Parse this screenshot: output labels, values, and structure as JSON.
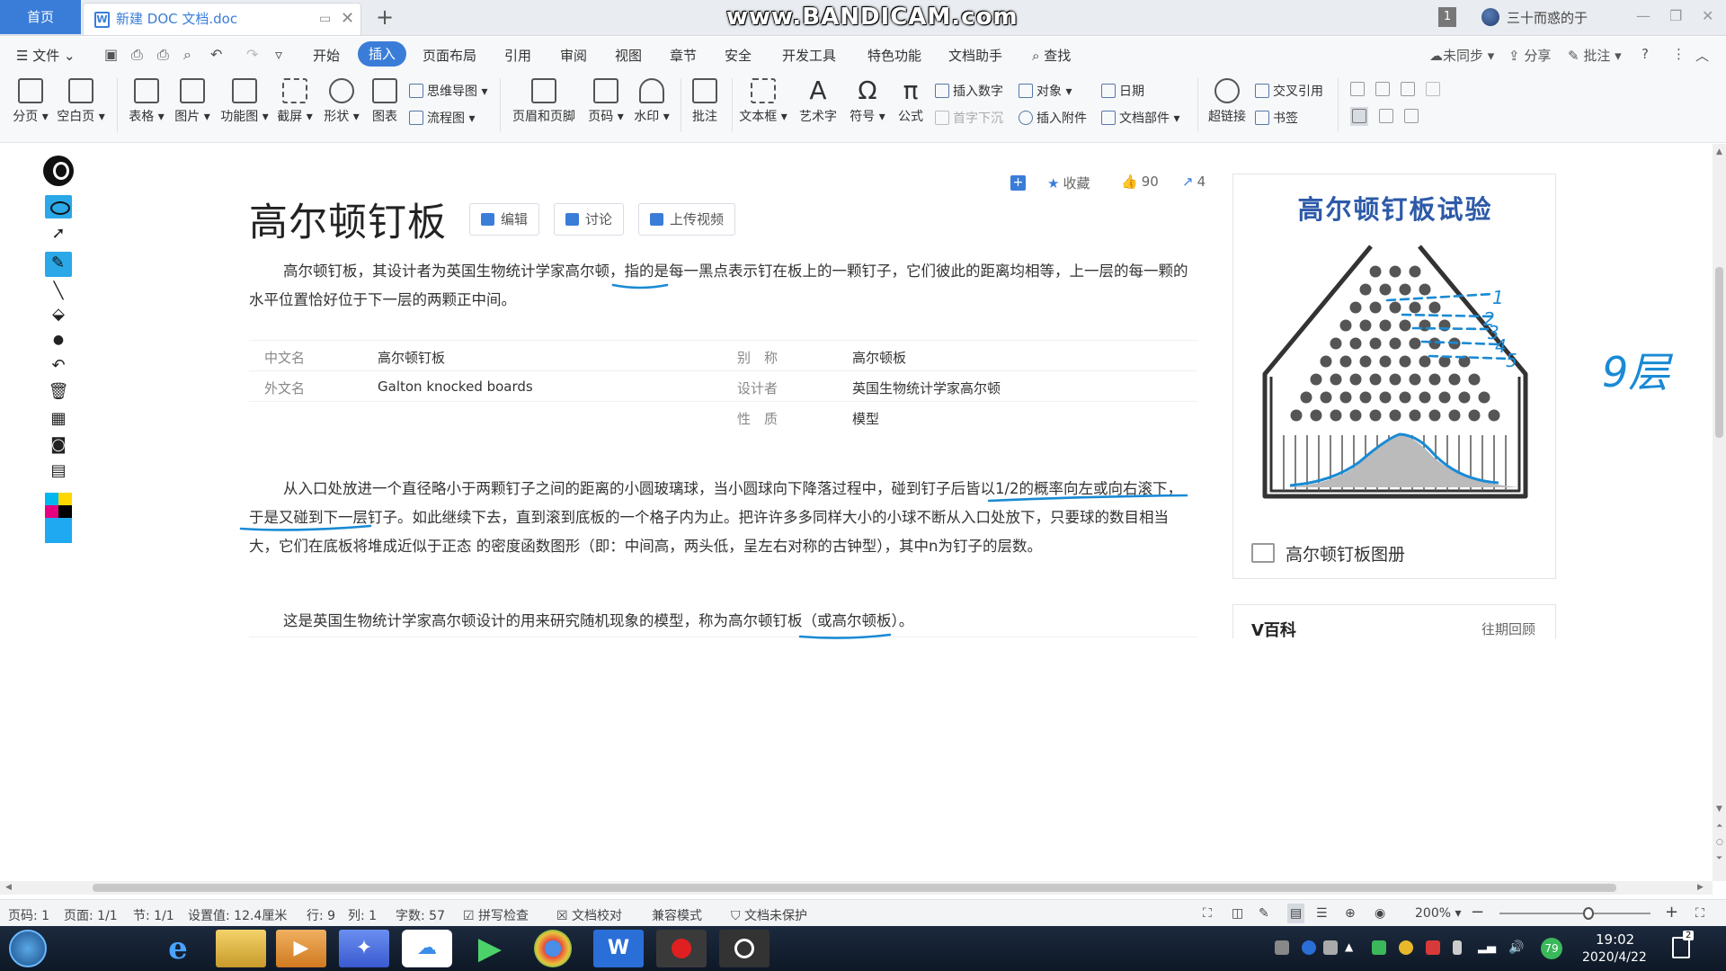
{
  "tabs": {
    "home": "首页",
    "doc": "新建 DOC 文档.doc",
    "doc_icon": "W",
    "new": "+"
  },
  "watermark": "www.BANDICAM.com",
  "titlebar": {
    "badge": "1",
    "user": "三十而惑的于"
  },
  "menu": {
    "file": "文件",
    "items": [
      "开始",
      "插入",
      "页面布局",
      "引用",
      "审阅",
      "视图",
      "章节",
      "安全",
      "开发工具",
      "特色功能",
      "文档助手"
    ],
    "search": "查找",
    "sync": "未同步",
    "share": "分享",
    "comment": "批注"
  },
  "ribbon": {
    "page_break": "分页",
    "blank_page": "空白页",
    "table": "表格",
    "picture": "图片",
    "function_chart": "功能图",
    "screenshot": "截屏",
    "shape": "形状",
    "chart": "图表",
    "mindmap": "思维导图",
    "flowchart": "流程图",
    "header_footer": "页眉和页脚",
    "page_number": "页码",
    "watermark": "水印",
    "annotation": "批注",
    "textbox": "文本框",
    "wordart": "艺术字",
    "symbol": "符号",
    "formula": "公式",
    "insert_number": "插入数字",
    "object": "对象",
    "date": "日期",
    "drop_cap": "首字下沉",
    "attachment": "插入附件",
    "doc_parts": "文档部件",
    "hyperlink": "超链接",
    "cross_ref": "交叉引用",
    "bookmark": "书签"
  },
  "article": {
    "title": "高尔顿钉板",
    "btn_edit": "编辑",
    "btn_discuss": "讨论",
    "btn_upload": "上传视频",
    "fav": "收藏",
    "likes": "90",
    "shares": "4",
    "p1": "高尔顿钉板，其设计者为英国生物统计学家高尔顿，指的是每一黑点表示钉在板上的一颗钉子，它们彼此的距离均相等，上一层的每一颗的水平位置恰好位于下一层的两颗正中间。",
    "info": [
      {
        "k": "中文名",
        "v": "高尔顿钉板",
        "k2": "别　称",
        "v2": "高尔顿板"
      },
      {
        "k": "外文名",
        "v": "Galton knocked boards",
        "k2": "设计者",
        "v2": "英国生物统计学家高尔顿"
      },
      {
        "k": "",
        "v": "",
        "k2": "性　质",
        "v2": "模型"
      }
    ],
    "p2": "从入口处放进一个直径略小于两颗钉子之间的距离的小圆玻璃球，当小圆球向下降落过程中，碰到钉子后皆以1/2的概率向左或向右滚下，于是又碰到下一层钉子。如此继续下去，直到滚到底板的一个格子内为止。把许许多多同样大小的小球不断从入口处放下，只要球的数目相当大，它们在底板将堆成近似于正态 的密度函数图形（即：中间高，两头低，呈左右对称的古钟型），其中n为钉子的层数。",
    "p3": "这是英国生物统计学家高尔顿设计的用来研究随机现象的模型，称为高尔顿钉板（或高尔顿板）。"
  },
  "sidebar": {
    "image_title": "高尔顿钉板试验",
    "album": "高尔顿钉板图册",
    "vbaike": "V百科",
    "past": "往期回顾"
  },
  "ink": {
    "labels": [
      "1",
      "2",
      "3",
      "4",
      "5"
    ],
    "note": "9层",
    "color": "#1a8ad4"
  },
  "status": {
    "page": "页码: 1",
    "pages": "页面: 1/1",
    "section": "节: 1/1",
    "setting": "设置值: 12.4厘米",
    "row": "行: 9",
    "col": "列: 1",
    "words": "字数: 57",
    "spell": "拼写检查",
    "proof": "文档校对",
    "compat": "兼容模式",
    "protect": "文档未保护",
    "zoom": "200%",
    "zoom_level": 0.59
  },
  "taskbar": {
    "time": "19:02",
    "date": "2020/4/22",
    "battery": "79",
    "notify": "2",
    "wps": "W"
  }
}
